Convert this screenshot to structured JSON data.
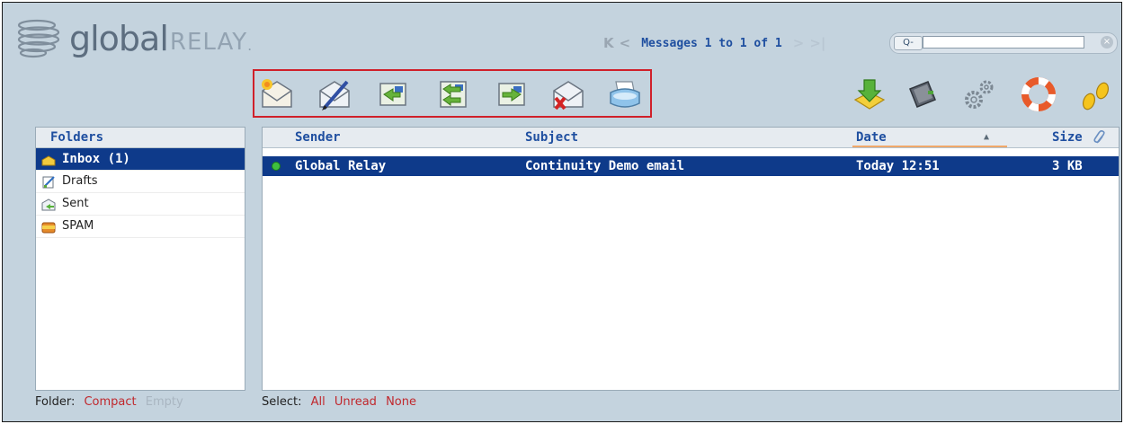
{
  "logo": {
    "global": "global",
    "relay": "RELAY",
    "dot": "."
  },
  "pager": {
    "first": "K",
    "prev": "<",
    "text": "Messages 1 to 1 of 1",
    "next": ">",
    "last": ">|"
  },
  "search": {
    "button_label": "Q-",
    "value": "",
    "placeholder": ""
  },
  "toolbar": {
    "icons": [
      "new-message-icon",
      "compose-icon",
      "reply-icon",
      "reply-all-icon",
      "forward-icon",
      "delete-icon",
      "print-icon"
    ]
  },
  "utility_icons": [
    "download-icon",
    "address-book-icon",
    "settings-icon",
    "help-icon",
    "logout-icon"
  ],
  "folders": {
    "header": "Folders",
    "items": [
      {
        "label": "Inbox (1)",
        "icon": "inbox-icon",
        "selected": true
      },
      {
        "label": "Drafts",
        "icon": "drafts-icon",
        "selected": false
      },
      {
        "label": "Sent",
        "icon": "sent-icon",
        "selected": false
      },
      {
        "label": "SPAM",
        "icon": "spam-icon",
        "selected": false
      }
    ]
  },
  "messages": {
    "columns": {
      "sender": "Sender",
      "subject": "Subject",
      "date": "Date",
      "size": "Size"
    },
    "sort_indicator": "▲",
    "rows": [
      {
        "sender": "Global Relay",
        "subject": "Continuity Demo email",
        "date": "Today 12:51",
        "size": "3 KB"
      }
    ]
  },
  "footer_left": {
    "label": "Folder:",
    "compact": "Compact",
    "empty": "Empty"
  },
  "footer_right": {
    "label": "Select:",
    "all": "All",
    "unread": "Unread",
    "none": "None"
  },
  "colors": {
    "background": "#c4d3de",
    "selection": "#0e3a8a",
    "header_text": "#1f4fa0",
    "link": "#c0282d",
    "highlight_box": "#d0202a"
  }
}
